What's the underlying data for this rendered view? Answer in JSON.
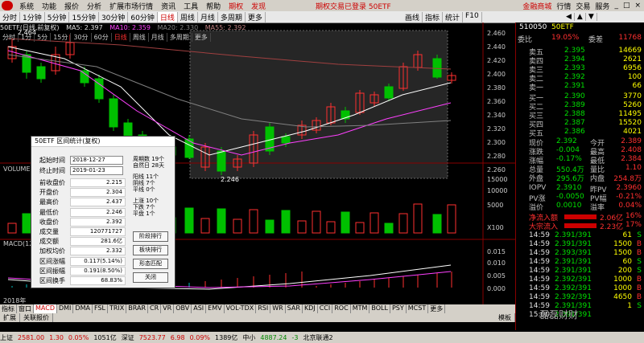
{
  "menu": {
    "items": [
      "系统",
      "功能",
      "报价",
      "分析",
      "扩展市场行情",
      "资讯",
      "工具",
      "帮助",
      "期权",
      "发现"
    ],
    "center": "期权交易已登录  50ETF",
    "right": [
      "金融商城",
      "行情",
      "交易",
      "服务"
    ]
  },
  "toolbar": {
    "periods": [
      "分时",
      "1分钟",
      "5分钟",
      "15分钟",
      "30分钟",
      "60分钟",
      "日线",
      "周线",
      "月线",
      "多周期",
      "更多"
    ],
    "active_period": "日线",
    "right_buttons": [
      "画线",
      "指标",
      "统计",
      "F10"
    ]
  },
  "chart_header": {
    "title": "50ETF(日线,前复权)",
    "ma": [
      "MA5: 2.397",
      "MA10: 2.359",
      "MA20: 2.330",
      "MA55: 2.392"
    ],
    "high_label": "2.464",
    "low_label": "2.246"
  },
  "subtabs": [
    "分时",
    "1分",
    "5分",
    "15分",
    "30分",
    "60分",
    "日线",
    "周线",
    "月线",
    "多周期",
    "更多"
  ],
  "y_axis": [
    "2.460",
    "2.440",
    "2.420",
    "2.400",
    "2.380",
    "2.360",
    "2.340",
    "2.320",
    "2.300",
    "2.280",
    "2.260"
  ],
  "volume": {
    "label": "VOLUME",
    "axis": [
      "15000",
      "10000",
      "5000",
      "X100"
    ]
  },
  "macd": {
    "label": "MACD(12",
    "axis": [
      "0.015",
      "0.010",
      "0.005",
      "0.000"
    ]
  },
  "year_label": "2018年",
  "dialog": {
    "title": "50ETF 区间统计(复权)",
    "start_label": "起始时间",
    "start_value": "2018-12-27",
    "end_label": "终止时间",
    "end_value": "2019-01-23",
    "right_info": [
      "周期数 19个",
      "自然日 28天",
      "阳线 11个",
      "阴线 7个",
      "平线 0个",
      "上涨 10个",
      "下跌 7个",
      "平盘 1个"
    ],
    "rows": [
      {
        "label": "前收盘价",
        "value": "2.215"
      },
      {
        "label": "开盘价",
        "value": "2.304"
      },
      {
        "label": "最高价",
        "value": "2.437"
      },
      {
        "label": "最低价",
        "value": "2.246"
      },
      {
        "label": "收盘价",
        "value": "2.392"
      },
      {
        "label": "成交量",
        "value": "120771727"
      },
      {
        "label": "成交额",
        "value": "281.6亿"
      },
      {
        "label": "加权均价",
        "value": "2.332"
      },
      {
        "label": "区间涨幅",
        "value": "0.117(5.14%)"
      },
      {
        "label": "区间振幅",
        "value": "0.191(8.50%)"
      },
      {
        "label": "区间换手",
        "value": "68.83%"
      }
    ],
    "buttons": [
      "阶段排行",
      "板块排行",
      "形态匹配",
      "关闭"
    ]
  },
  "quote": {
    "code": "510050",
    "name": "50ETF",
    "weibi_label": "委比",
    "weibi": "19.05%",
    "weicha_label": "委差",
    "weicha": "11768",
    "asks": [
      {
        "label": "卖五",
        "price": "2.395",
        "vol": "14669"
      },
      {
        "label": "卖四",
        "price": "2.394",
        "vol": "2621"
      },
      {
        "label": "卖三",
        "price": "2.393",
        "vol": "6956"
      },
      {
        "label": "卖二",
        "price": "2.392",
        "vol": "100"
      },
      {
        "label": "卖一",
        "price": "2.391",
        "vol": "66"
      }
    ],
    "bids": [
      {
        "label": "买一",
        "price": "2.390",
        "vol": "3770"
      },
      {
        "label": "买二",
        "price": "2.389",
        "vol": "5260"
      },
      {
        "label": "买三",
        "price": "2.388",
        "vol": "11495"
      },
      {
        "label": "买四",
        "price": "2.387",
        "vol": "15520"
      },
      {
        "label": "买五",
        "price": "2.386",
        "vol": "4021"
      }
    ],
    "stats": [
      {
        "l1": "现价",
        "v1": "2.392",
        "l2": "今开",
        "v2": "2.389"
      },
      {
        "l1": "涨跌",
        "v1": "-0.004",
        "l2": "最高",
        "v2": "2.408"
      },
      {
        "l1": "涨幅",
        "v1": "-0.17%",
        "l2": "最低",
        "v2": "2.384"
      },
      {
        "l1": "总量",
        "v1": "550.4万",
        "l2": "量比",
        "v2": "1.10"
      },
      {
        "l1": "外盘",
        "v1": "295.6万",
        "l2": "内盘",
        "v2": "254.8万"
      }
    ],
    "iopv": [
      {
        "l1": "IOPV",
        "v1": "2.3910",
        "l2": "昨PV",
        "v2": "2.3960"
      },
      {
        "l1": "PV涨",
        "v1": "-0.0050",
        "l2": "PV幅",
        "v2": "-0.21%"
      },
      {
        "l1": "溢价",
        "v1": "0.0010",
        "l2": "溢率",
        "v2": "0.04%"
      }
    ],
    "flows": [
      {
        "label": "净流入额",
        "value": "2.06亿",
        "pct": "16%"
      },
      {
        "label": "大宗流入",
        "value": "2.23亿",
        "pct": "17%"
      }
    ],
    "ticks": [
      {
        "t": "14:59",
        "p": "2.391/391",
        "v": "61",
        "f": "S"
      },
      {
        "t": "14:59",
        "p": "2.391/391",
        "v": "1500",
        "f": "B"
      },
      {
        "t": "14:59",
        "p": "2.393/391",
        "v": "1500",
        "f": "B"
      },
      {
        "t": "14:59",
        "p": "2.391/391",
        "v": "60",
        "f": "S"
      },
      {
        "t": "14:59",
        "p": "2.391/391",
        "v": "200",
        "f": "S"
      },
      {
        "t": "14:59",
        "p": "2.392/391",
        "v": "1000",
        "f": "B"
      },
      {
        "t": "14:59",
        "p": "2.392/391",
        "v": "1000",
        "f": "B"
      },
      {
        "t": "14:59",
        "p": "2.392/391",
        "v": "4650",
        "f": "B"
      },
      {
        "t": "14:59",
        "p": "2.391/391",
        "v": "1",
        "f": "S"
      },
      {
        "t": "15:00",
        "p": "2.391/391",
        "v": "",
        "f": ""
      }
    ]
  },
  "indicator_tabs": [
    "指标",
    "窗口",
    "MACD",
    "DMI",
    "DMA",
    "FSL",
    "TRIX",
    "BRAR",
    "CR",
    "VR",
    "OBV",
    "ASI",
    "EMV",
    "VOL-TDX",
    "RSI",
    "WR",
    "SAR",
    "KDJ",
    "CCI",
    "ROC",
    "MTM",
    "BOLL",
    "PSY",
    "MCST",
    "更多"
  ],
  "active_indicator": "MACD",
  "ext_tabs": [
    "扩展",
    "关联报价"
  ],
  "bottom_side": "模板",
  "status": [
    {
      "name": "上证",
      "value": "2581.00",
      "chg": "1.30",
      "pct": "0.05%",
      "amt": "1051亿"
    },
    {
      "name": "深证",
      "value": "7523.77",
      "chg": "6.98",
      "pct": "0.09%",
      "amt": "1389亿"
    },
    {
      "name": "中小",
      "value": "4887.24",
      "chg": "-3",
      "pct": "",
      "amt": ""
    }
  ],
  "status_right": "北京联通2",
  "watermark": "磊磊财财"
}
